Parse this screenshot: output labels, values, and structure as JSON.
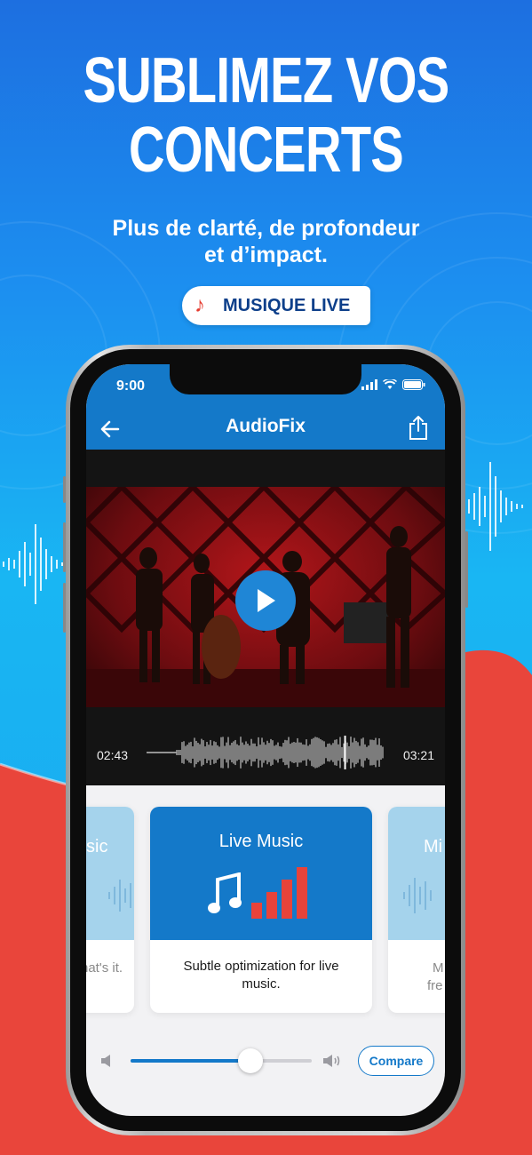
{
  "promo": {
    "headline_line1": "SUBLIMEZ VOS",
    "headline_line2": "CONCERTS",
    "subtitle_line1": "Plus de clarté, de profondeur",
    "subtitle_line2": "et d’impact.",
    "badge_label": "MUSIQUE LIVE",
    "badge_icon": "music-note-icon"
  },
  "statusbar": {
    "time": "9:00"
  },
  "navbar": {
    "title": "AudioFix",
    "back_icon": "arrow-left-icon",
    "share_icon": "share-icon"
  },
  "player": {
    "current_time": "02:43",
    "total_time": "03:21",
    "progress": 0.81
  },
  "presets": [
    {
      "title": "Music",
      "visible_title": "sic",
      "visible_desc": "hat's it."
    },
    {
      "title": "Live Music",
      "description": "Subtle optimization for live music."
    },
    {
      "title": "Mi",
      "visible_desc_1": "M",
      "visible_desc_2": "fre"
    }
  ],
  "controls": {
    "volume_level": 0.66,
    "compare_label": "Compare"
  },
  "colors": {
    "accent": "#1479c9",
    "live_bars": "#e8433a",
    "card_inactive": "#a5d3ec"
  }
}
